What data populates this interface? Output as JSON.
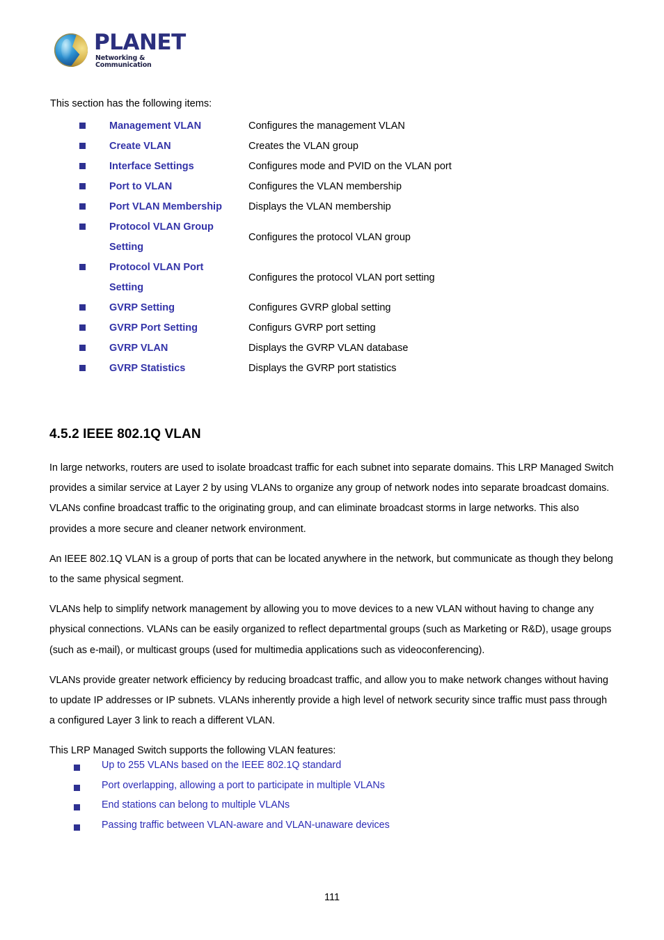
{
  "logo": {
    "brand": "PLANET",
    "tagline": "Networking & Communication",
    "brand_color": "#2b2f7e"
  },
  "intro_text": "This section has the following items:",
  "bullet_color": "#2e3192",
  "link_color": "#3333a8",
  "feature_color": "#2b2bb5",
  "items": [
    {
      "label": "Management VLAN",
      "desc": "Configures the management VLAN",
      "two_line": false
    },
    {
      "label": "Create VLAN",
      "desc": "Creates the VLAN group",
      "two_line": false
    },
    {
      "label": "Interface Settings",
      "desc": "Configures mode and PVID on the VLAN port",
      "two_line": false
    },
    {
      "label": "Port to VLAN",
      "desc": "Configures the VLAN membership",
      "two_line": false
    },
    {
      "label": "Port VLAN Membership",
      "desc": "Displays the VLAN membership",
      "two_line": false
    },
    {
      "label": "Protocol VLAN Group Setting",
      "desc": "Configures the protocol VLAN group",
      "two_line": true,
      "line1": "Protocol VLAN Group",
      "line2": "Setting"
    },
    {
      "label": "Protocol VLAN Port Setting",
      "desc": "Configures the protocol VLAN port setting",
      "two_line": true,
      "line1": "Protocol VLAN Port",
      "line2": "Setting"
    },
    {
      "label": "GVRP Setting",
      "desc": "Configures GVRP global setting",
      "two_line": false
    },
    {
      "label": "GVRP Port Setting",
      "desc": "Configurs GVRP port setting",
      "two_line": false
    },
    {
      "label": "GVRP VLAN",
      "desc": "Displays the GVRP VLAN database",
      "two_line": false
    },
    {
      "label": "GVRP Statistics",
      "desc": "Displays the GVRP port statistics",
      "two_line": false
    }
  ],
  "section": {
    "heading": "4.5.2 IEEE 802.1Q VLAN",
    "paragraphs": [
      "In large networks, routers are used to isolate broadcast traffic for each subnet into separate domains. This LRP Managed Switch provides a similar service at Layer 2 by using VLANs to organize any group of network nodes into separate broadcast domains. VLANs confine broadcast traffic to the originating group, and can eliminate broadcast storms in large networks. This also provides a more secure and cleaner network environment.",
      "An IEEE 802.1Q VLAN is a group of ports that can be located anywhere in the network, but communicate as though they belong to the same physical segment.",
      "VLANs help to simplify network management by allowing you to move devices to a new VLAN without having to change any physical connections. VLANs can be easily organized to reflect departmental groups (such as Marketing or R&D), usage groups (such as e-mail), or multicast groups (used for multimedia applications such as videoconferencing).",
      "VLANs provide greater network efficiency by reducing broadcast traffic, and allow you to make network changes without having to update IP addresses or IP subnets. VLANs inherently provide a high level of network security since traffic must pass through a configured Layer 3 link to reach a different VLAN.",
      "This LRP Managed Switch supports the following VLAN features:"
    ]
  },
  "features": [
    "Up to 255 VLANs based on the IEEE 802.1Q standard",
    "Port overlapping, allowing a port to participate in multiple VLANs",
    "End stations can belong to multiple VLANs",
    "Passing traffic between VLAN-aware and VLAN-unaware devices"
  ],
  "footer": {
    "page_number": "111"
  }
}
